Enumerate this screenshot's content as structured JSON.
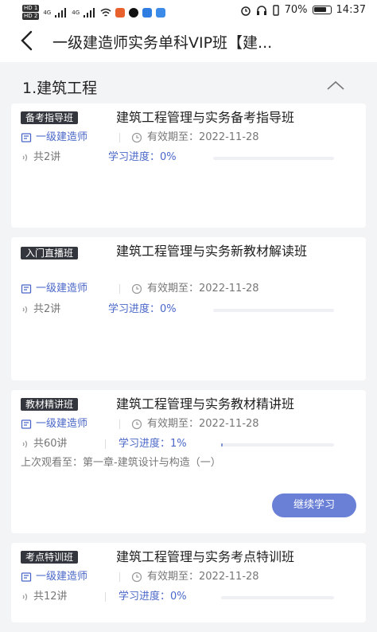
{
  "status_bar": {
    "battery": "70%",
    "time": "14:37",
    "hd1": "HD 1",
    "hd2": "HD 2",
    "net1": "4G",
    "net2": "4G"
  },
  "header": {
    "title": "一级建造师实务单科VIP班【建..."
  },
  "section": {
    "title": "1.建筑工程"
  },
  "courses": [
    {
      "tag": "备考指导班",
      "title": "建筑工程管理与实务备考指导班",
      "category": "一级建造师",
      "validity": "有效期至：2022-11-28",
      "lessons": "共2讲",
      "progress_label": "学习进度：0%",
      "progress": 0
    },
    {
      "tag": "入门直播班",
      "title": "建筑工程管理与实务新教材解读班",
      "category": "一级建造师",
      "validity": "有效期至：2022-11-28",
      "lessons": "共2讲",
      "progress_label": "学习进度：0%",
      "progress": 0
    },
    {
      "tag": "教材精讲班",
      "title": "建筑工程管理与实务教材精讲班",
      "category": "一级建造师",
      "validity": "有效期至：2022-11-28",
      "lessons": "共60讲",
      "progress_label": "学习进度：1%",
      "progress": 0.01,
      "last_watched": "上次观看至：第一章-建筑设计与构造（一）",
      "continue_label": "继续学习"
    },
    {
      "tag": "考点特训班",
      "title": "建筑工程管理与实务考点特训班",
      "category": "一级建造师",
      "validity": "有效期至：2022-11-28",
      "lessons": "共12讲",
      "progress_label": "学习进度：0%",
      "progress": 0
    }
  ],
  "colors": {
    "accent": "#6a7fd6",
    "tag_bg": "#33363d",
    "link": "#4a67c8"
  }
}
